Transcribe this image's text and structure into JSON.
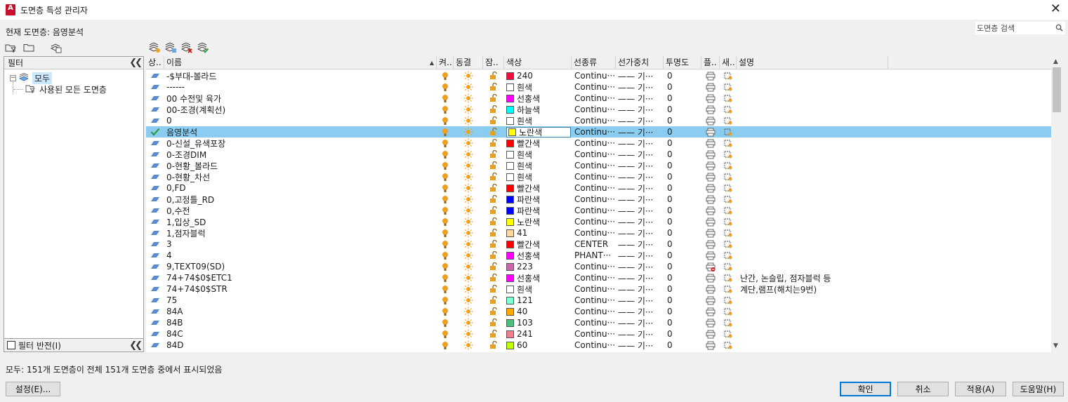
{
  "window": {
    "title": "도면층 특성 관리자",
    "app_icon_letter": "A",
    "app_icon_color": "#c8102e"
  },
  "current_layer_text": "현재 도면층: 음영분석",
  "search": {
    "label": "도면층 검색",
    "value": ""
  },
  "filter_panel": {
    "header": "필터",
    "tree": [
      {
        "label": "모두",
        "selected": true
      },
      {
        "label": "사용된 모든 도면층",
        "selected": false
      }
    ],
    "invert_label": "필터 반전(I)",
    "invert_checked": false
  },
  "columns": [
    "상..",
    "이름",
    "켜..",
    "동결",
    "잠..",
    "색상",
    "선종류",
    "선가중치",
    "투명도",
    "플..",
    "새..",
    "설명"
  ],
  "layers": [
    {
      "name": "-$부대-볼라드",
      "color_name": "240",
      "color": "#ee0f3f",
      "linetype": "Continu···",
      "lineweight": "—— 기···",
      "transparency": "0",
      "desc": "",
      "current": false,
      "plot_off": false
    },
    {
      "name": "------",
      "color_name": "흰색",
      "color": "#ffffff",
      "linetype": "Continu···",
      "lineweight": "—— 기···",
      "transparency": "0",
      "desc": "",
      "current": false,
      "plot_off": false
    },
    {
      "name": "00 수전및 육가",
      "color_name": "선홍색",
      "color": "#ff00ff",
      "linetype": "Continu···",
      "lineweight": "—— 기···",
      "transparency": "0",
      "desc": "",
      "current": false,
      "plot_off": false
    },
    {
      "name": "00-조경(계획선)",
      "color_name": "하늘색",
      "color": "#00ffff",
      "linetype": "Continu···",
      "lineweight": "—— 기···",
      "transparency": "0",
      "desc": "",
      "current": false,
      "plot_off": false
    },
    {
      "name": "0",
      "color_name": "흰색",
      "color": "#ffffff",
      "linetype": "Continu···",
      "lineweight": "—— 기···",
      "transparency": "0",
      "desc": "",
      "current": false,
      "plot_off": false
    },
    {
      "name": "음영분석",
      "color_name": "노란색",
      "color": "#ffff00",
      "linetype": "Continu···",
      "lineweight": "—— 기···",
      "transparency": "0",
      "desc": "",
      "current": true,
      "plot_off": false
    },
    {
      "name": "0-신설_유색포장",
      "color_name": "빨간색",
      "color": "#ff0000",
      "linetype": "Continu···",
      "lineweight": "—— 기···",
      "transparency": "0",
      "desc": "",
      "current": false,
      "plot_off": false
    },
    {
      "name": "0-조경DIM",
      "color_name": "흰색",
      "color": "#ffffff",
      "linetype": "Continu···",
      "lineweight": "—— 기···",
      "transparency": "0",
      "desc": "",
      "current": false,
      "plot_off": false
    },
    {
      "name": "0-현황_볼라드",
      "color_name": "흰색",
      "color": "#ffffff",
      "linetype": "Continu···",
      "lineweight": "—— 기···",
      "transparency": "0",
      "desc": "",
      "current": false,
      "plot_off": false
    },
    {
      "name": "0-현황_차선",
      "color_name": "흰색",
      "color": "#ffffff",
      "linetype": "Continu···",
      "lineweight": "—— 기···",
      "transparency": "0",
      "desc": "",
      "current": false,
      "plot_off": false
    },
    {
      "name": "0,FD",
      "color_name": "빨간색",
      "color": "#ff0000",
      "linetype": "Continu···",
      "lineweight": "—— 기···",
      "transparency": "0",
      "desc": "",
      "current": false,
      "plot_off": false
    },
    {
      "name": "0,고정틀_RD",
      "color_name": "파란색",
      "color": "#0000ff",
      "linetype": "Continu···",
      "lineweight": "—— 기···",
      "transparency": "0",
      "desc": "",
      "current": false,
      "plot_off": false
    },
    {
      "name": "0,수전",
      "color_name": "파란색",
      "color": "#0000ff",
      "linetype": "Continu···",
      "lineweight": "—— 기···",
      "transparency": "0",
      "desc": "",
      "current": false,
      "plot_off": false
    },
    {
      "name": "1,입상_SD",
      "color_name": "노란색",
      "color": "#ffff00",
      "linetype": "Continu···",
      "lineweight": "—— 기···",
      "transparency": "0",
      "desc": "",
      "current": false,
      "plot_off": false
    },
    {
      "name": "1,점자블럭",
      "color_name": "41",
      "color": "#ffd9a0",
      "linetype": "Continu···",
      "lineweight": "—— 기···",
      "transparency": "0",
      "desc": "",
      "current": false,
      "plot_off": false
    },
    {
      "name": "3",
      "color_name": "빨간색",
      "color": "#ff0000",
      "linetype": "CENTER",
      "lineweight": "—— 기···",
      "transparency": "0",
      "desc": "",
      "current": false,
      "plot_off": false
    },
    {
      "name": "4",
      "color_name": "선홍색",
      "color": "#ff00ff",
      "linetype": "PHANT···",
      "lineweight": "—— 기···",
      "transparency": "0",
      "desc": "",
      "current": false,
      "plot_off": false
    },
    {
      "name": "9,TEXT09(SD)",
      "color_name": "223",
      "color": "#cc66aa",
      "linetype": "Continu···",
      "lineweight": "—— 기···",
      "transparency": "0",
      "desc": "",
      "current": false,
      "plot_off": true
    },
    {
      "name": "74+74$0$ETC1",
      "color_name": "선홍색",
      "color": "#ff00ff",
      "linetype": "Continu···",
      "lineweight": "—— 기···",
      "transparency": "0",
      "desc": "난간, 논슬립, 점자블럭 등",
      "current": false,
      "plot_off": false
    },
    {
      "name": "74+74$0$STR",
      "color_name": "흰색",
      "color": "#ffffff",
      "linetype": "Continu···",
      "lineweight": "—— 기···",
      "transparency": "0",
      "desc": "계단,램프(해치는9번)",
      "current": false,
      "plot_off": false
    },
    {
      "name": "75",
      "color_name": "121",
      "color": "#7fffd4",
      "linetype": "Continu···",
      "lineweight": "—— 기···",
      "transparency": "0",
      "desc": "",
      "current": false,
      "plot_off": false
    },
    {
      "name": "84A",
      "color_name": "40",
      "color": "#ffaa00",
      "linetype": "Continu···",
      "lineweight": "—— 기···",
      "transparency": "0",
      "desc": "",
      "current": false,
      "plot_off": false
    },
    {
      "name": "84B",
      "color_name": "103",
      "color": "#4cbf7f",
      "linetype": "Continu···",
      "lineweight": "—— 기···",
      "transparency": "0",
      "desc": "",
      "current": false,
      "plot_off": false
    },
    {
      "name": "84C",
      "color_name": "241",
      "color": "#f07f8f",
      "linetype": "Continu···",
      "lineweight": "—— 기···",
      "transparency": "0",
      "desc": "",
      "current": false,
      "plot_off": false
    },
    {
      "name": "84D",
      "color_name": "60",
      "color": "#bfff00",
      "linetype": "Continu···",
      "lineweight": "—— 기···",
      "transparency": "0",
      "desc": "",
      "current": false,
      "plot_off": false
    }
  ],
  "status_text": "모두: 151개 도면층이 전체 151개 도면층 중에서 표시되었음",
  "buttons": {
    "settings": "설정(E)...",
    "ok": "확인",
    "cancel": "취소",
    "apply": "적용(A)",
    "help": "도움말(H)"
  },
  "colors": {
    "selected_row": "#8bcdf0",
    "bulb": "#f0a020",
    "sun": "#f0a020",
    "lock": "#e8a020",
    "layer_icon": "#3a78c8",
    "current_check": "#2a9a3a"
  }
}
